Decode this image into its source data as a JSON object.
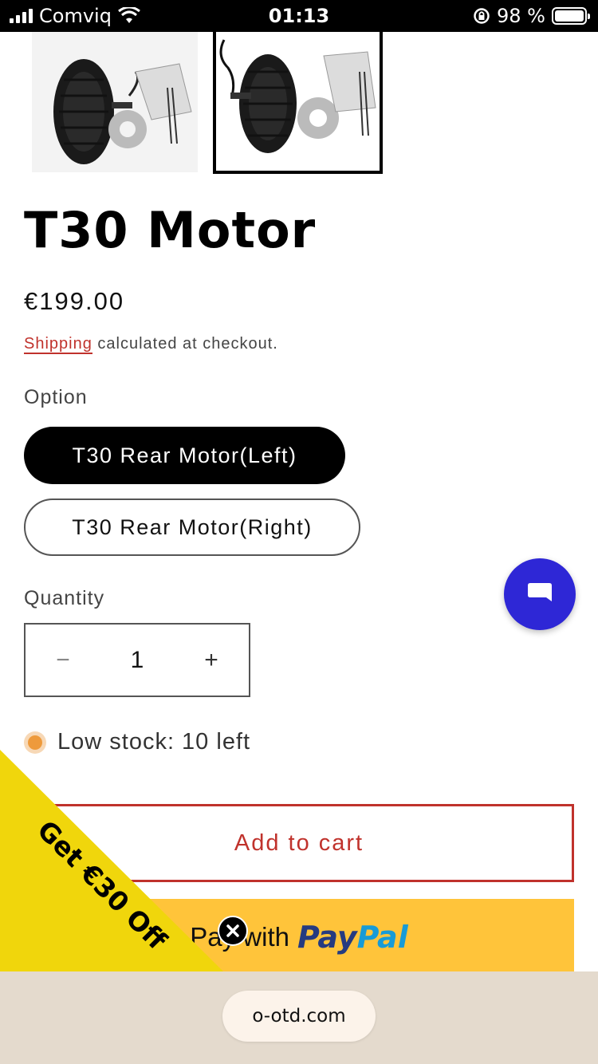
{
  "status_bar": {
    "carrier": "Comviq",
    "time": "01:13",
    "battery_percent": "98 %"
  },
  "product": {
    "title": "T30 Motor",
    "price": "€199.00",
    "shipping_link": "Shipping",
    "shipping_suffix": " calculated at checkout.",
    "option_label": "Option",
    "options": [
      {
        "label": "T30 Rear Motor(Left)",
        "selected": true
      },
      {
        "label": "T30 Rear Motor(Right)",
        "selected": false
      }
    ],
    "quantity_label": "Quantity",
    "quantity": "1",
    "minus_symbol": "−",
    "plus_symbol": "+",
    "stock_text": "Low stock: 10 left",
    "add_to_cart": "Add to cart",
    "paypal_prefix": "Pay with",
    "paypal_logo_a": "Pay",
    "paypal_logo_b": "Pal"
  },
  "promo": {
    "text": "Get €30 Off",
    "color": "#f0d60c"
  },
  "browser": {
    "url": "o-otd.com"
  },
  "colors": {
    "accent": "#c0322c",
    "chat": "#2e27d6",
    "paypal_bg": "#ffc43a",
    "stock_dot": "#ee9a3c"
  },
  "icons": [
    "signal-icon",
    "wifi-icon",
    "orientation-lock-icon",
    "battery-icon",
    "chat-icon",
    "close-icon"
  ]
}
